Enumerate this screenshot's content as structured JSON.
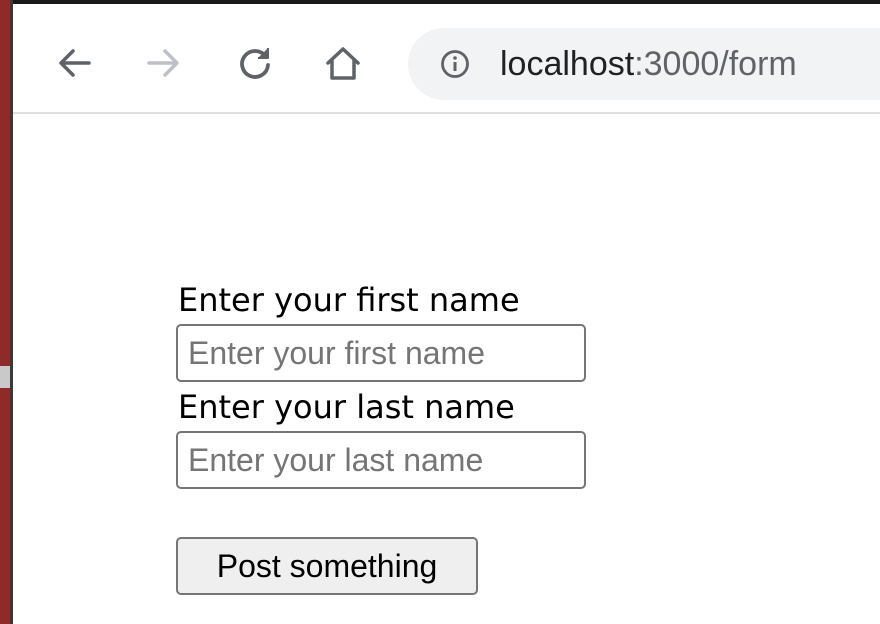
{
  "browser": {
    "url_host": "localhost",
    "url_rest": ":3000/form",
    "icons": {
      "back": "back-arrow-icon",
      "forward": "forward-arrow-icon",
      "reload": "reload-icon",
      "home": "home-icon",
      "site_info": "info-icon"
    }
  },
  "form": {
    "first_name": {
      "label": "Enter your first name",
      "placeholder": "Enter your first name",
      "value": ""
    },
    "last_name": {
      "label": "Enter your last name",
      "placeholder": "Enter your last name",
      "value": ""
    },
    "submit_label": "Post something"
  }
}
